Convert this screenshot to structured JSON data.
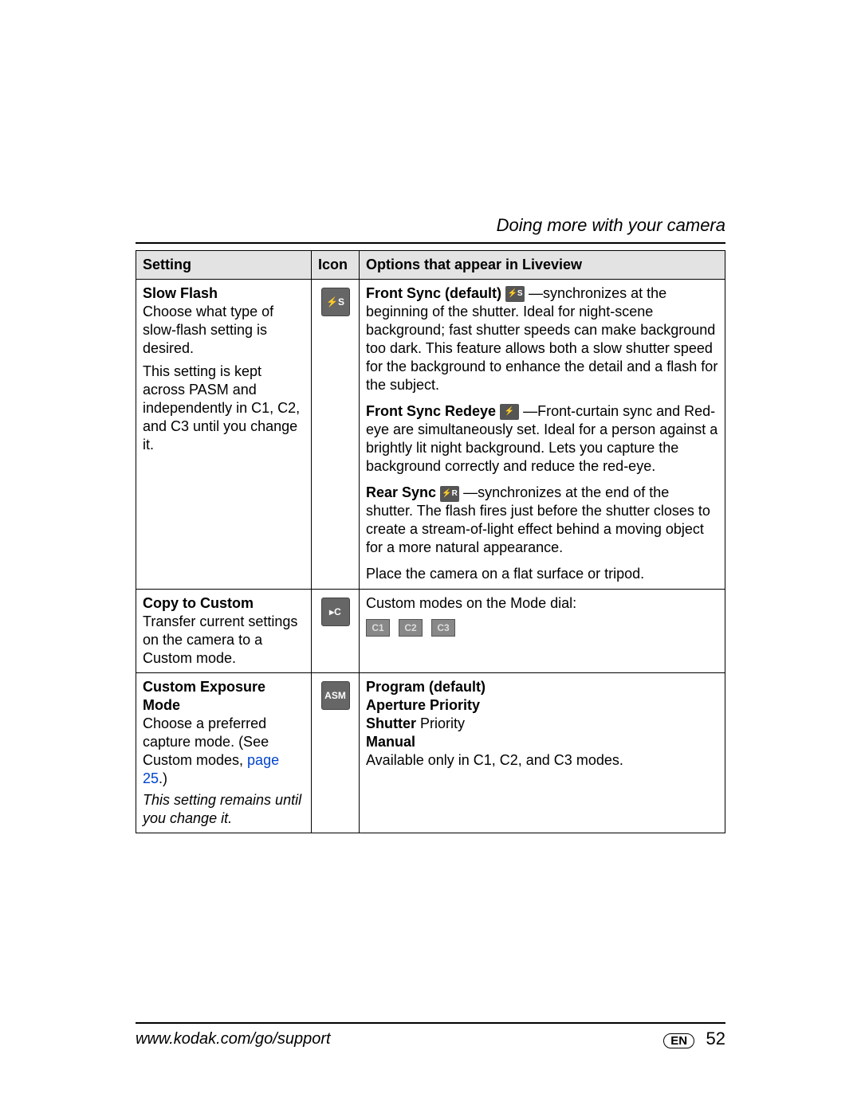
{
  "header": {
    "section_title": "Doing more with your camera"
  },
  "table": {
    "headers": {
      "setting": "Setting",
      "icon": "Icon",
      "options": "Options that appear in Liveview"
    },
    "rows": {
      "slow_flash": {
        "title": "Slow Flash",
        "desc1": "Choose what type of slow-flash setting is desired.",
        "desc2": "This setting is kept across PASM and independently in C1, C2, and C3 until you change it.",
        "icon_label": "⚡S",
        "front_sync": {
          "label": "Front Sync (default)",
          "icon": "⚡S",
          "text": "—synchronizes at the beginning of the shutter. Ideal for night-scene background; fast shutter speeds can make background too dark. This feature allows both a slow shutter speed for the background to enhance the detail and a flash for the subject."
        },
        "front_sync_redeye": {
          "label": "Front Sync Redeye",
          "icon": "⚡👁",
          "text": "—Front-curtain sync and Red-eye are simultaneously set. Ideal for a person against a brightly lit night background. Lets you capture the background correctly and reduce the red-eye."
        },
        "rear_sync": {
          "label": "Rear Sync",
          "icon": "⚡R",
          "text": "—synchronizes at the end of the shutter. The flash fires just before the shutter closes to create a stream-of-light effect behind a moving object for a more natural appearance."
        },
        "tripod_note": "Place the camera on a flat surface or tripod."
      },
      "copy_to_custom": {
        "title": "Copy to Custom",
        "desc": "Transfer current settings on the camera to a Custom mode.",
        "icon_label": "▸C",
        "options_intro": "Custom modes on the Mode dial:",
        "chips": {
          "c1": "C1",
          "c2": "C2",
          "c3": "C3"
        }
      },
      "custom_exposure": {
        "title": "Custom Exposure Mode",
        "desc_pre": "Choose a preferred capture mode. (See Custom modes, ",
        "link": "page 25",
        "desc_post": ".)",
        "note": "This setting remains until you change it.",
        "icon_label": "ASM",
        "opts": {
          "program": "Program (default)",
          "aperture": "Aperture Priority",
          "shutter_b": "Shutter",
          "shutter_n": " Priority",
          "manual": "Manual",
          "avail": "Available only in C1, C2, and C3 modes."
        }
      }
    }
  },
  "footer": {
    "url": "www.kodak.com/go/support",
    "lang": "EN",
    "page": "52"
  }
}
